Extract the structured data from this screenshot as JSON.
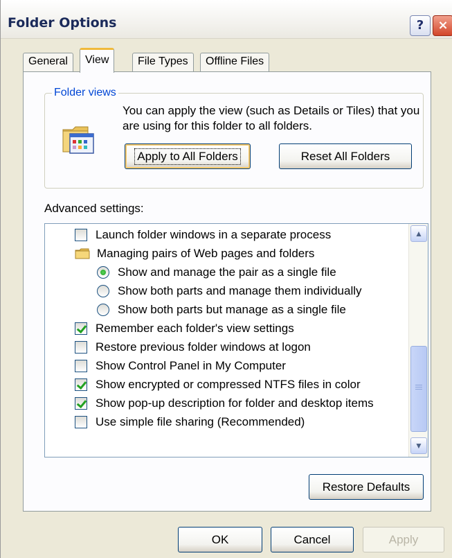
{
  "window": {
    "title": "Folder Options",
    "help_glyph": "?",
    "close_glyph": "×"
  },
  "tabs": [
    {
      "label": "General",
      "active": false
    },
    {
      "label": "View",
      "active": true
    },
    {
      "label": "File Types",
      "active": false
    },
    {
      "label": "Offline Files",
      "active": false
    }
  ],
  "folder_views": {
    "group_title": "Folder views",
    "description": "You can apply the view (such as Details or Tiles) that you are using for this folder to all folders.",
    "apply_all_label": "Apply to All Folders",
    "reset_all_label": "Reset All Folders"
  },
  "advanced": {
    "label": "Advanced settings:",
    "items": [
      {
        "kind": "checkbox",
        "label": "Launch folder windows in a separate process",
        "checked": false
      },
      {
        "kind": "folder",
        "label": "Managing pairs of Web pages and folders"
      },
      {
        "kind": "radio",
        "label": "Show and manage the pair as a single file",
        "checked": true
      },
      {
        "kind": "radio",
        "label": "Show both parts and manage them individually",
        "checked": false
      },
      {
        "kind": "radio",
        "label": "Show both parts but manage as a single file",
        "checked": false
      },
      {
        "kind": "checkbox",
        "label": "Remember each folder's view settings",
        "checked": true
      },
      {
        "kind": "checkbox",
        "label": "Restore previous folder windows at logon",
        "checked": false
      },
      {
        "kind": "checkbox",
        "label": "Show Control Panel in My Computer",
        "checked": false
      },
      {
        "kind": "checkbox",
        "label": "Show encrypted or compressed NTFS files in color",
        "checked": true
      },
      {
        "kind": "checkbox",
        "label": "Show pop-up description for folder and desktop items",
        "checked": true
      },
      {
        "kind": "checkbox",
        "label": "Use simple file sharing (Recommended)",
        "checked": false
      }
    ],
    "restore_defaults_label": "Restore Defaults"
  },
  "footer": {
    "ok_label": "OK",
    "cancel_label": "Cancel",
    "apply_label": "Apply"
  },
  "colors": {
    "window_bg": "#ece9d8",
    "accent_blue": "#0046d5",
    "check_green": "#21a121",
    "active_tab_highlight": "#f0b93a"
  }
}
